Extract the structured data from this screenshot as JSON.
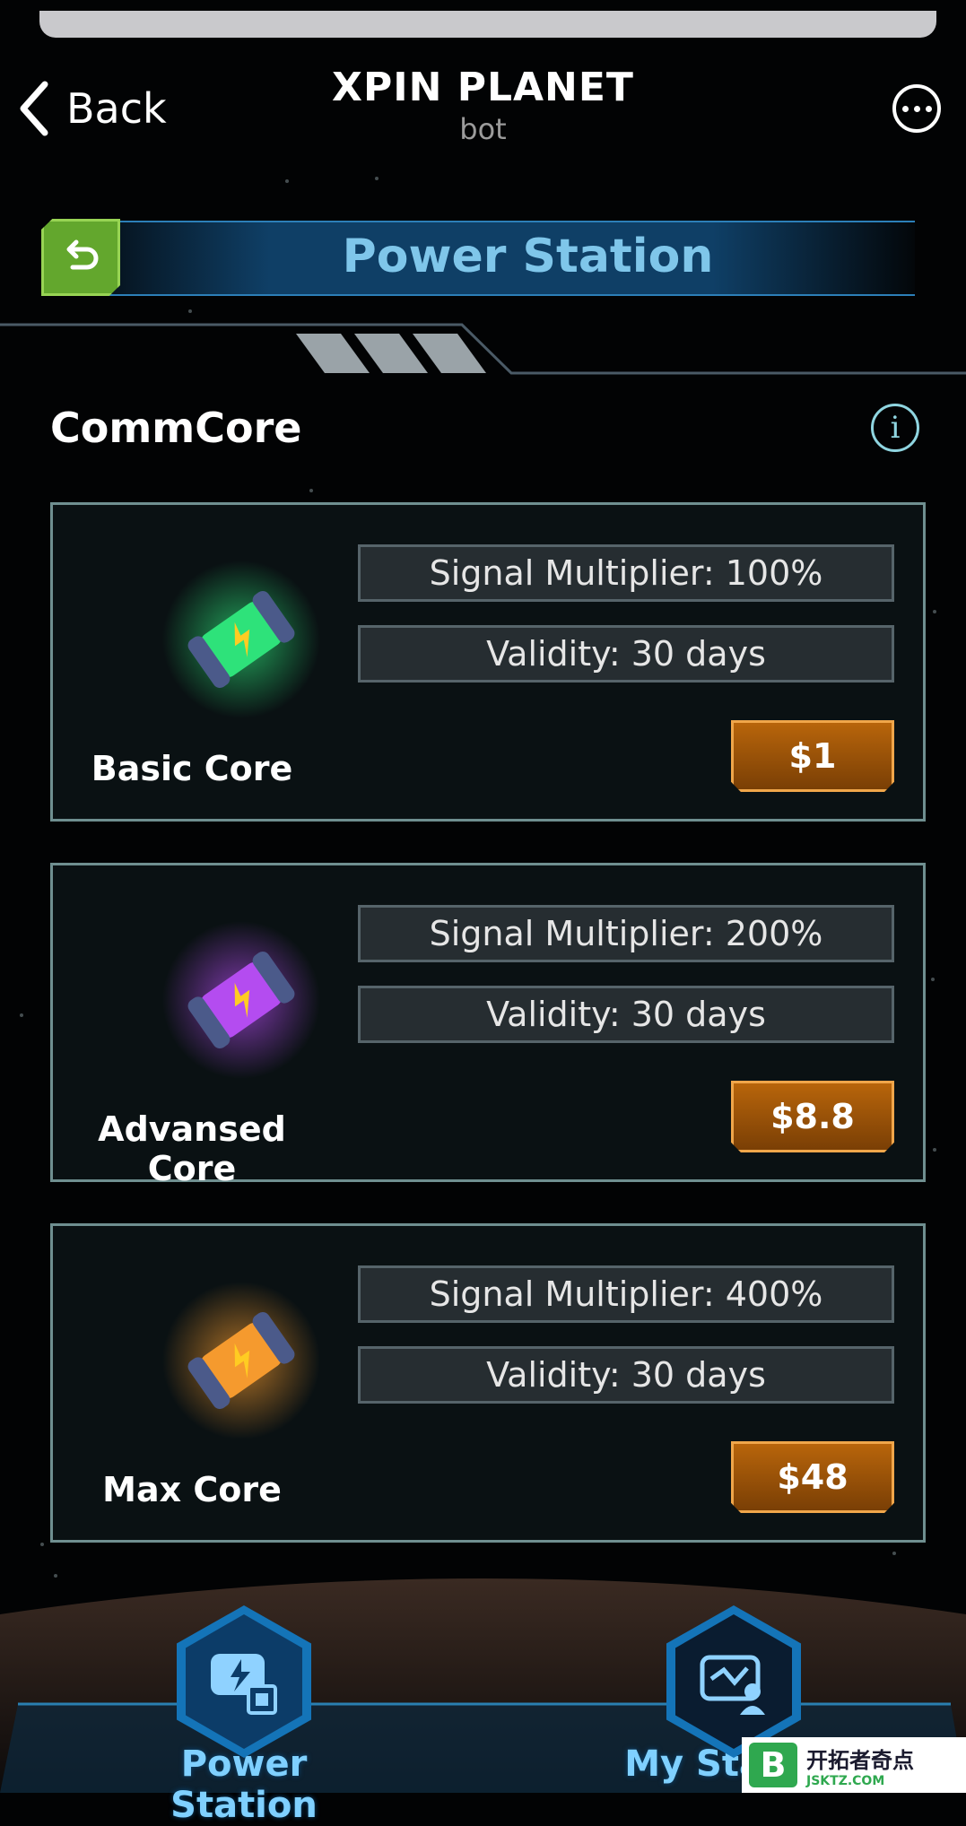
{
  "header": {
    "back_label": "Back",
    "title": "XPIN PLANET",
    "subtitle": "bot"
  },
  "banner": {
    "title": "Power Station"
  },
  "section": {
    "title": "CommCore"
  },
  "cores": [
    {
      "name": "Basic Core",
      "multiplier": "Signal Multiplier: 100%",
      "validity": "Validity: 30 days",
      "price": "$1",
      "color": "#2ee27a"
    },
    {
      "name": "Advansed Core",
      "multiplier": "Signal Multiplier: 200%",
      "validity": "Validity: 30 days",
      "price": "$8.8",
      "color": "#b44cf0"
    },
    {
      "name": "Max Core",
      "multiplier": "Signal Multiplier: 400%",
      "validity": "Validity: 30 days",
      "price": "$48",
      "color": "#f59a2e"
    }
  ],
  "nav": {
    "power_station": "Power Station",
    "my_station": "My Station"
  },
  "watermark": {
    "logo": "B",
    "title": "开拓者奇点",
    "site": "JSKTZ.COM"
  }
}
